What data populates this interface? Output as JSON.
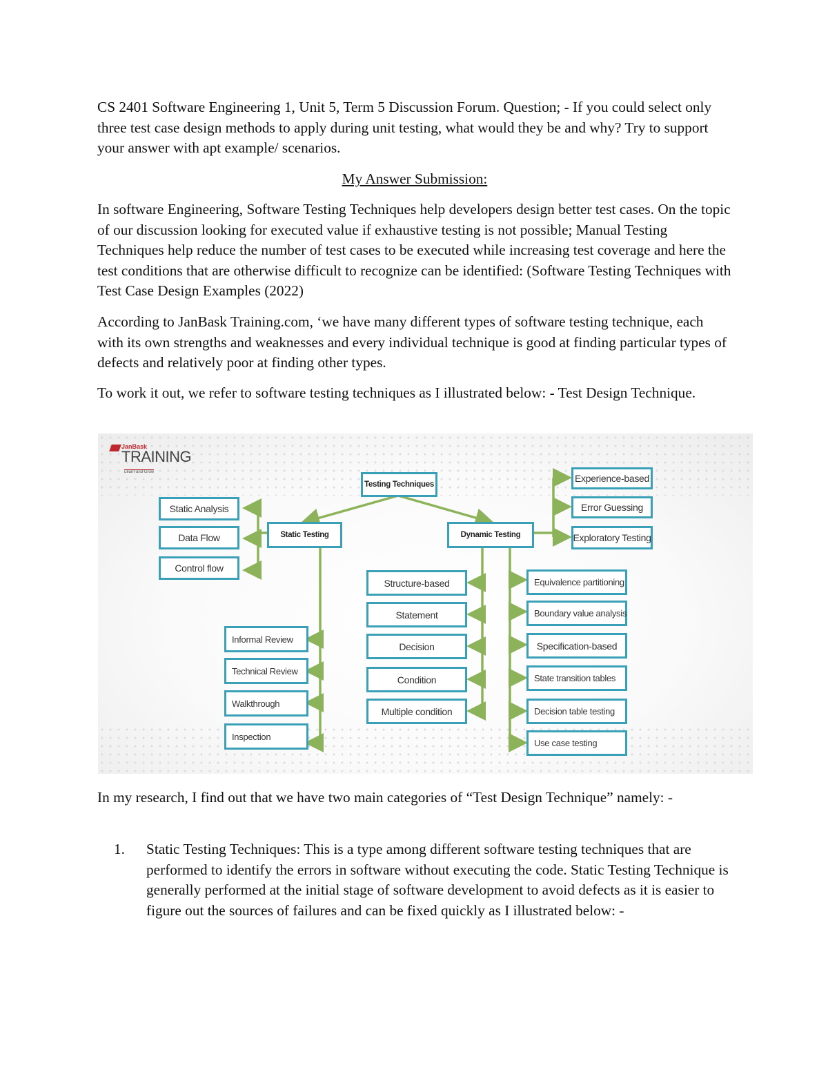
{
  "document": {
    "intro": "CS 2401 Software Engineering 1, Unit 5, Term 5 Discussion Forum.          Question; - If you could select only three test case design methods to apply during unit testing, what would they be and why? Try to support your answer with apt example/ scenarios.",
    "heading": "My Answer Submission:",
    "paragraphs": [
      "In software Engineering, Software Testing Techniques help developers design better test cases. On the topic of our discussion looking for executed value if exhaustive testing is not possible; Manual Testing Techniques help reduce the number of test cases to be executed while increasing test coverage and here the test conditions that are otherwise difficult to recognize can be identified: (Software Testing Techniques with Test Case Design Examples (2022)",
      "According to JanBask Training.com, ‘we have many different types of software testing technique, each with its own strengths and weaknesses and every individual technique is good at finding particular types of defects and relatively poor at finding other types.",
      "To work it out, we refer to software testing techniques as I illustrated below: - Test Design Technique."
    ],
    "after_figure": "In my research, I find out that we have two main categories of “Test Design Technique” namely: -",
    "list": [
      {
        "number": "1.",
        "text": "Static Testing Techniques: This is a type among different software testing techniques that are performed to identify the errors in software without executing the code. Static Testing Technique is generally performed at the initial stage of software development to avoid defects as it is easier to figure out the sources of failures and can be fixed quickly as I illustrated below: -"
      }
    ]
  },
  "figure": {
    "logo": {
      "brand_small": "JanBask",
      "brand_large": "TRAINING",
      "tagline": "Learn and Grow"
    },
    "root": "Testing Techniques",
    "static": {
      "label": "Static Testing",
      "top_children": [
        "Static Analysis",
        "Data Flow",
        "Control flow"
      ],
      "bottom_children": [
        "Informal Review",
        "Technical Review",
        "Walkthrough",
        "Inspection"
      ]
    },
    "dynamic": {
      "label": "Dynamic Testing",
      "experience_children": [
        "Experience-based",
        "Error Guessing",
        "Exploratory Testing"
      ],
      "structure_children": [
        "Structure-based",
        "Statement",
        "Decision",
        "Condition",
        "Multiple condition"
      ],
      "specification_children": [
        "Equivalence partitioning",
        "Boundary value analysis",
        "Specification-based",
        "State transition tables",
        "Decision table testing",
        "Use case testing"
      ]
    },
    "colors": {
      "box_border": "#3aa0b8",
      "connector": "#8db35a",
      "logo_red": "#c0262d"
    }
  }
}
